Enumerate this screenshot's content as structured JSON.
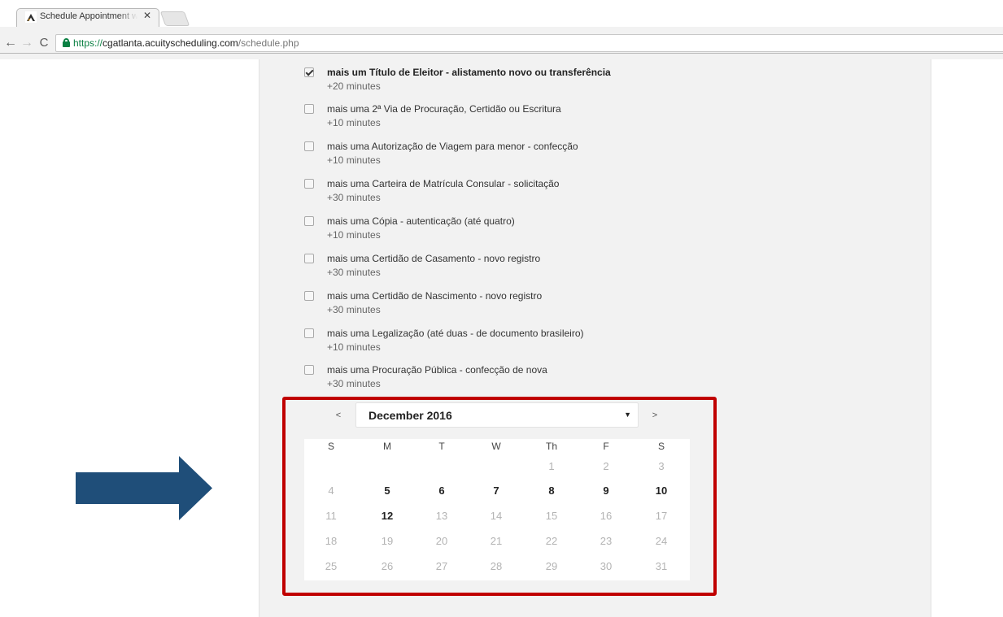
{
  "browser": {
    "tab_title": "Schedule Appointment w",
    "tab_close": "✕",
    "nav_back": "←",
    "nav_forward": "→",
    "nav_reload": "C",
    "url_scheme": "https://",
    "url_host": "cgatlanta.acuityscheduling.com",
    "url_path": "/schedule.php"
  },
  "addons": [
    {
      "name": "mais um Título de Eleitor - alistamento novo ou transferência",
      "duration": "+20 minutes",
      "checked": true
    },
    {
      "name": "mais uma 2ª Via de Procuração, Certidão ou Escritura",
      "duration": "+10 minutes",
      "checked": false
    },
    {
      "name": "mais uma Autorização de Viagem para menor - confecção",
      "duration": "+10 minutes",
      "checked": false
    },
    {
      "name": "mais uma Carteira de Matrícula Consular - solicitação",
      "duration": "+30 minutes",
      "checked": false
    },
    {
      "name": "mais uma Cópia - autenticação (até quatro)",
      "duration": "+10 minutes",
      "checked": false
    },
    {
      "name": "mais uma Certidão de Casamento - novo registro",
      "duration": "+30 minutes",
      "checked": false
    },
    {
      "name": "mais uma Certidão de Nascimento - novo registro",
      "duration": "+30 minutes",
      "checked": false
    },
    {
      "name": "mais uma Legalização (até duas - de documento brasileiro)",
      "duration": "+10 minutes",
      "checked": false
    },
    {
      "name": "mais uma Procuração Pública - confecção de nova",
      "duration": "+30 minutes",
      "checked": false
    }
  ],
  "calendar": {
    "prev": "<",
    "next": ">",
    "month": "December 2016",
    "caret": "▼",
    "weekdays": [
      "S",
      "M",
      "T",
      "W",
      "Th",
      "F",
      "S"
    ],
    "weeks": [
      [
        "",
        "",
        "",
        "",
        "1",
        "2",
        "3"
      ],
      [
        "4",
        "5",
        "6",
        "7",
        "8",
        "9",
        "10"
      ],
      [
        "11",
        "12",
        "13",
        "14",
        "15",
        "16",
        "17"
      ],
      [
        "18",
        "19",
        "20",
        "21",
        "22",
        "23",
        "24"
      ],
      [
        "25",
        "26",
        "27",
        "28",
        "29",
        "30",
        "31"
      ]
    ],
    "available_days": [
      "5",
      "6",
      "7",
      "8",
      "9",
      "10",
      "12"
    ]
  },
  "colors": {
    "highlight": "#c00000",
    "arrow": "#1f4e79"
  }
}
